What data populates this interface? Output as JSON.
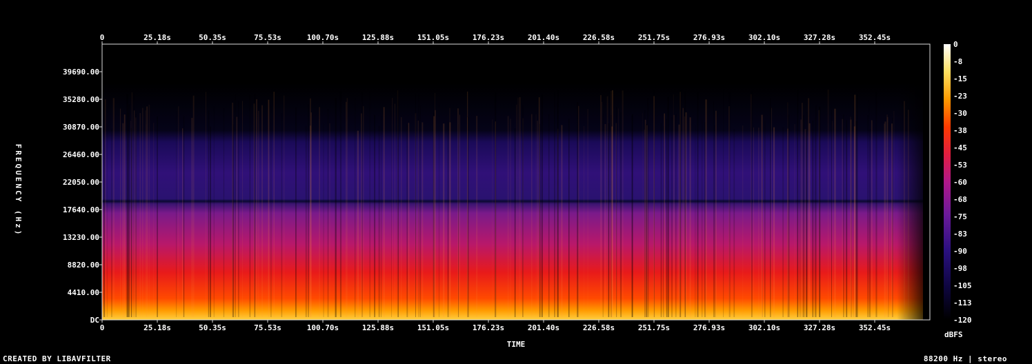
{
  "chart_data": {
    "type": "heatmap",
    "title": "",
    "xlabel": "TIME",
    "ylabel": "FREQUENCY (Hz)",
    "x_unit": "s",
    "y_unit": "Hz",
    "x_ticks": [
      "0",
      "25.18s",
      "50.35s",
      "75.53s",
      "100.70s",
      "125.88s",
      "151.05s",
      "176.23s",
      "201.40s",
      "226.58s",
      "251.75s",
      "276.93s",
      "302.10s",
      "327.28s",
      "352.45s"
    ],
    "y_ticks": [
      "DC",
      "4410.00",
      "8820.00",
      "13230.00",
      "17640.00",
      "22050.00",
      "26460.00",
      "30870.00",
      "35280.00",
      "39690.00"
    ],
    "y_values": [
      0,
      4410,
      8820,
      13230,
      17640,
      22050,
      26460,
      30870,
      35280,
      39690
    ],
    "xlim": [
      0,
      378
    ],
    "ylim": [
      0,
      44100
    ],
    "colorbar": {
      "label": "dBFS",
      "ticks": [
        "0",
        "-8",
        "-15",
        "-23",
        "-30",
        "-38",
        "-45",
        "-53",
        "-60",
        "-68",
        "-75",
        "-83",
        "-90",
        "-98",
        "-105",
        "-113",
        "-120"
      ],
      "range": [
        -120,
        0
      ],
      "colors": [
        "#000000",
        "#1a0f6b",
        "#5a1a9a",
        "#a0179a",
        "#d41a4a",
        "#ff2a00",
        "#ff8c00",
        "#ffd030",
        "#ffffc0",
        "#ffffff"
      ]
    }
  },
  "footer": {
    "created_by": "CREATED BY LIBAVFILTER",
    "format_info": "88200 Hz | stereo"
  }
}
